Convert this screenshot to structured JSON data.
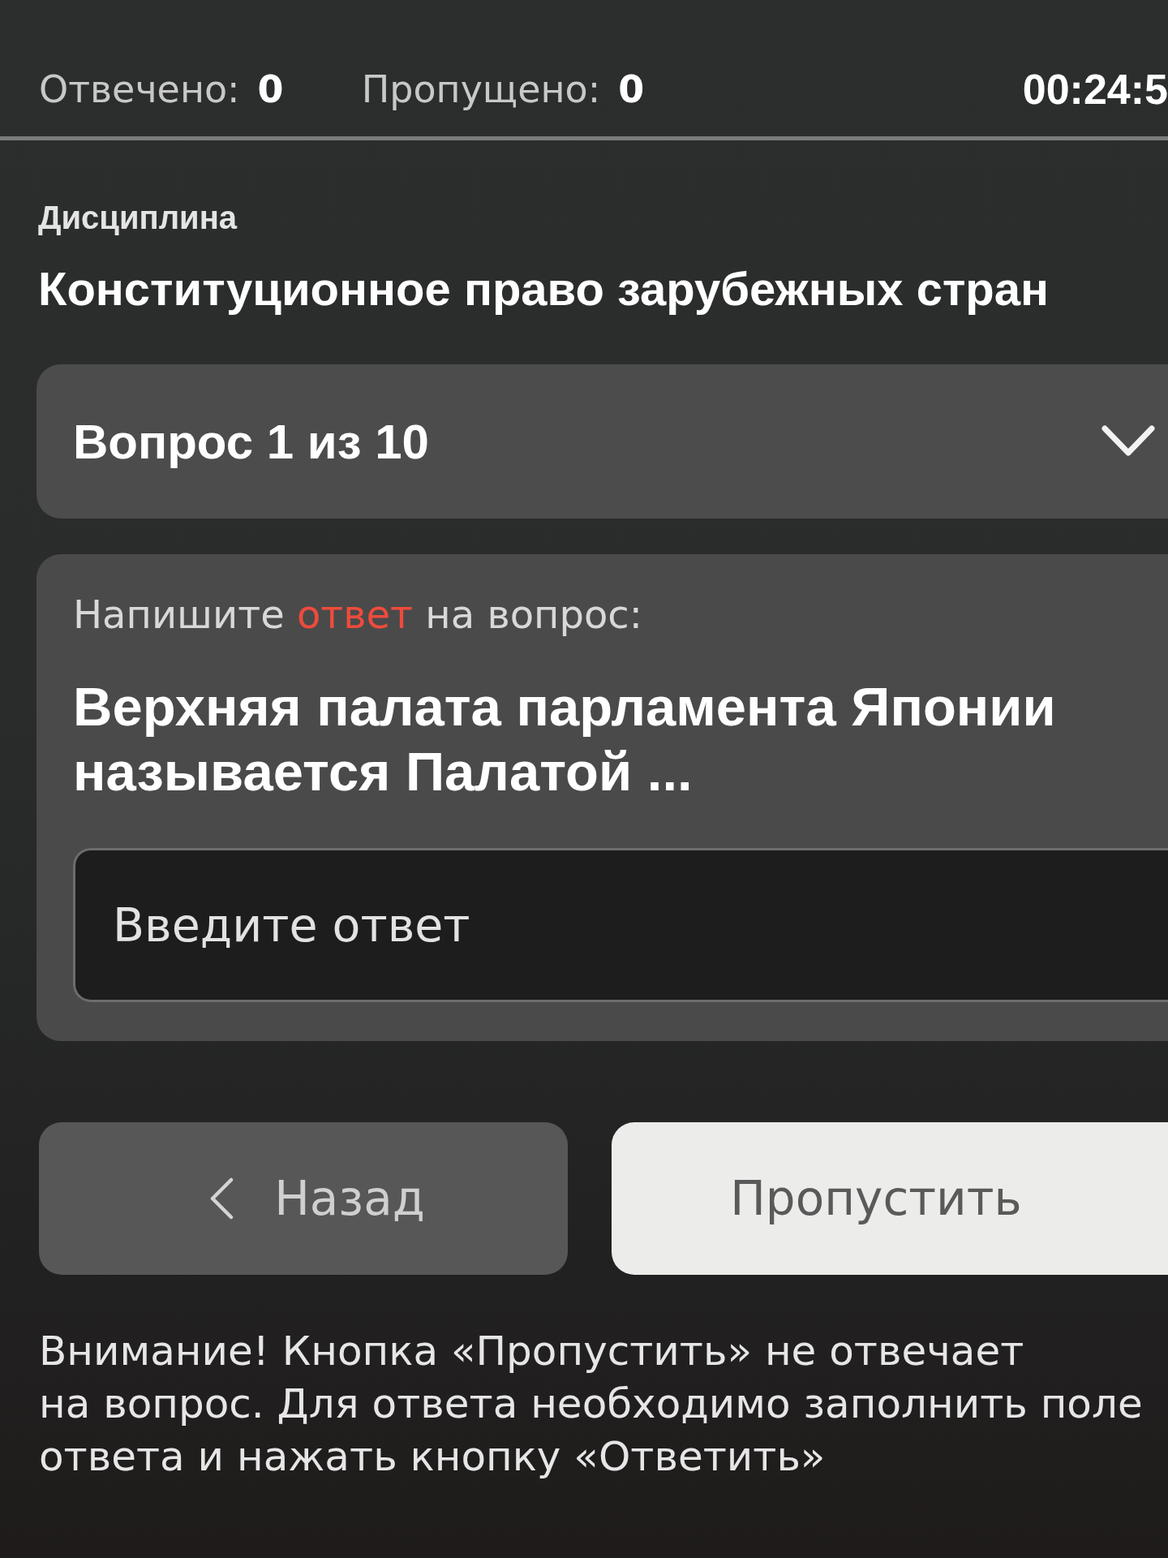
{
  "stats": [
    {
      "label": "Отвечено:",
      "value": "0"
    },
    {
      "label": "Пропущено:",
      "value": "0"
    }
  ],
  "timer": "00:24:5",
  "discipline": {
    "label": "Дисциплина",
    "name": "Конституционное право зарубежных стран"
  },
  "question_selector": {
    "label": "Вопрос 1 из 10",
    "expanded": false
  },
  "question_card": {
    "instruction": [
      {
        "text": "Напишите ",
        "highlight": false
      },
      {
        "text": "ответ",
        "highlight": true
      },
      {
        "text": " на вопрос:",
        "highlight": false
      }
    ],
    "question": "Верхняя палата парламента Японии называется Палатой ...",
    "answer_field": {
      "placeholder": "Введите ответ"
    }
  },
  "buttons": [
    {
      "kind": "back",
      "label": "Назад"
    },
    {
      "kind": "skip",
      "label": "Пропустить"
    }
  ],
  "notice": "Внимание! Кнопка «Пропустить» не отвечает\nна вопрос. Для ответа необходимо заполнить поле\nответа и нажать кнопку «Ответить»"
}
